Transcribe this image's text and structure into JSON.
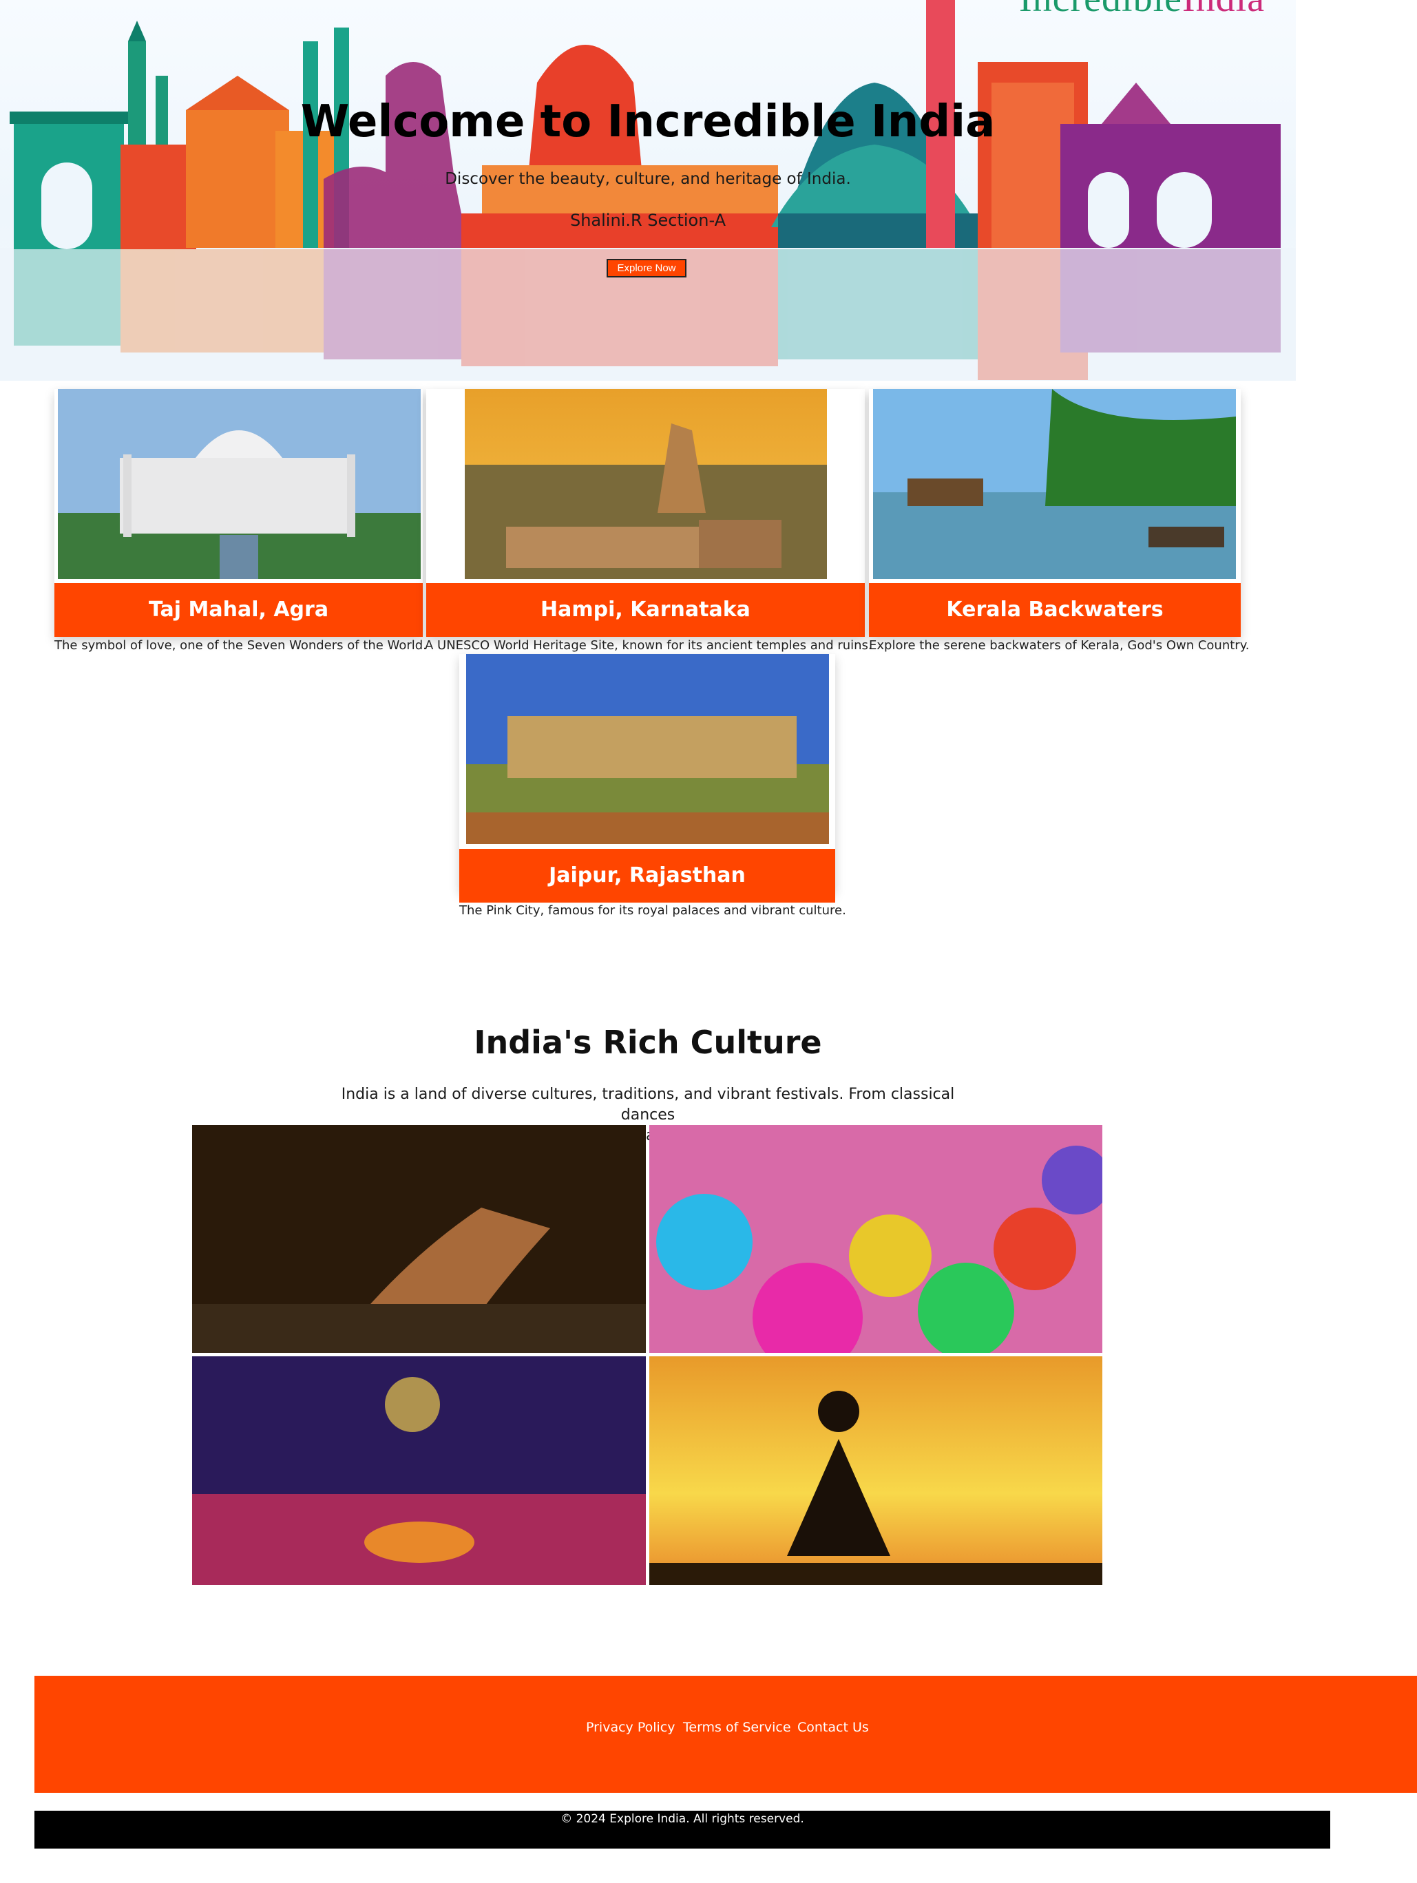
{
  "hero": {
    "title": "Welcome to Incredible India",
    "subtitle": "Discover the beauty, culture, and heritage of India.",
    "author": "Shalini.R Section-A",
    "button": "Explore Now",
    "logo_a": "Incredible",
    "logo_b": "India"
  },
  "destinations": [
    {
      "title": "Taj Mahal, Agra",
      "description": "The symbol of love, one of the Seven Wonders of the World."
    },
    {
      "title": "Hampi, Karnataka",
      "description": "A UNESCO World Heritage Site, known for its ancient temples and ruins."
    },
    {
      "title": "Kerala Backwaters",
      "description": "Explore the serene backwaters of Kerala, God's Own Country."
    },
    {
      "title": "Jaipur, Rajasthan",
      "description": "The Pink City, famous for its royal palaces and vibrant culture."
    }
  ],
  "culture": {
    "title": "India's Rich Culture",
    "text_line1": "India is a land of diverse cultures, traditions, and vibrant festivals. From classical dances",
    "text_line2": "? to folk music, every state has its unique cultural identity."
  },
  "footer": {
    "links": [
      "Privacy Policy",
      "Terms of Service",
      "Contact Us"
    ],
    "copyright": "© 2024 Explore India. All rights reserved."
  },
  "colors": {
    "accent": "#ff4500",
    "footer_bottom": "#000000"
  }
}
